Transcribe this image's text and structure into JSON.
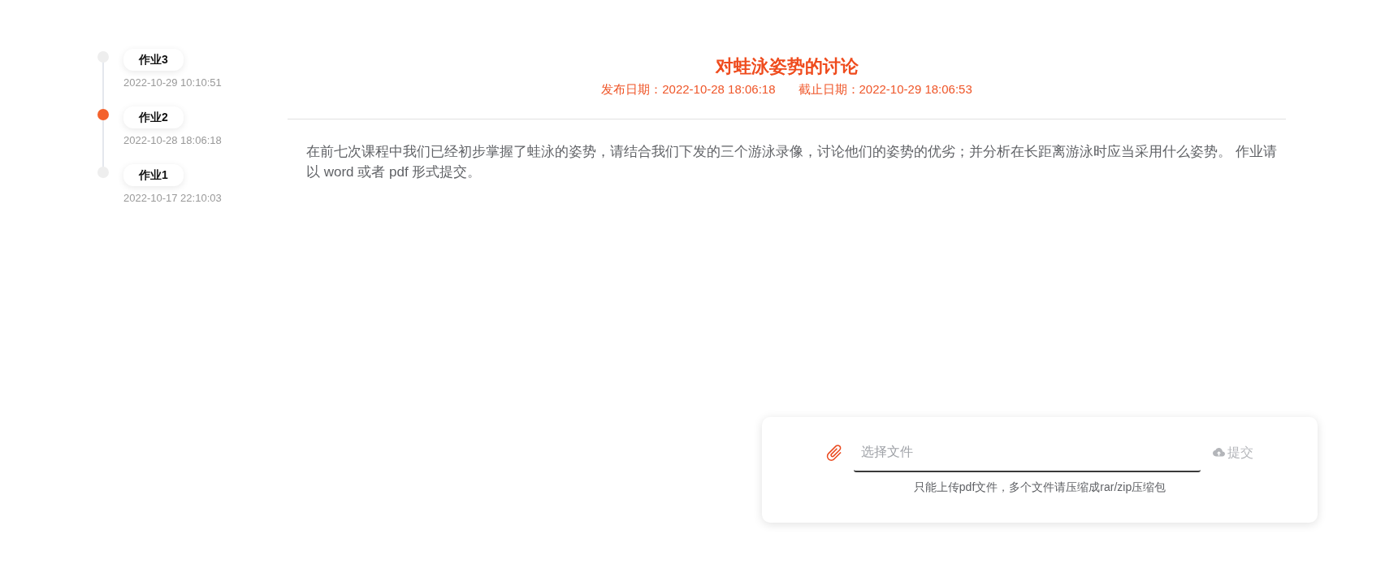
{
  "timeline": {
    "items": [
      {
        "label": "作业3",
        "time": "2022-10-29 10:10:51",
        "selected": false
      },
      {
        "label": "作业2",
        "time": "2022-10-28 18:06:18",
        "selected": true
      },
      {
        "label": "作业1",
        "time": "2022-10-17 22:10:03",
        "selected": false
      }
    ]
  },
  "assignment": {
    "title": "对蛙泳姿势的讨论",
    "publish_date": "发布日期：2022-10-28 18:06:18",
    "deadline": "截止日期：2022-10-29 18:06:53",
    "description": "在前七次课程中我们已经初步掌握了蛙泳的姿势，请结合我们下发的三个游泳录像，讨论他们的姿势的优劣；并分析在长距离游泳时应当采用什么姿势。 作业请以 word 或者 pdf 形式提交。"
  },
  "upload": {
    "file_field": {
      "placeholder": "选择文件"
    },
    "submit": {
      "label": "提交",
      "disabled": true
    },
    "hint": "只能上传pdf文件，多个文件请压缩成rar/zip压缩包"
  }
}
